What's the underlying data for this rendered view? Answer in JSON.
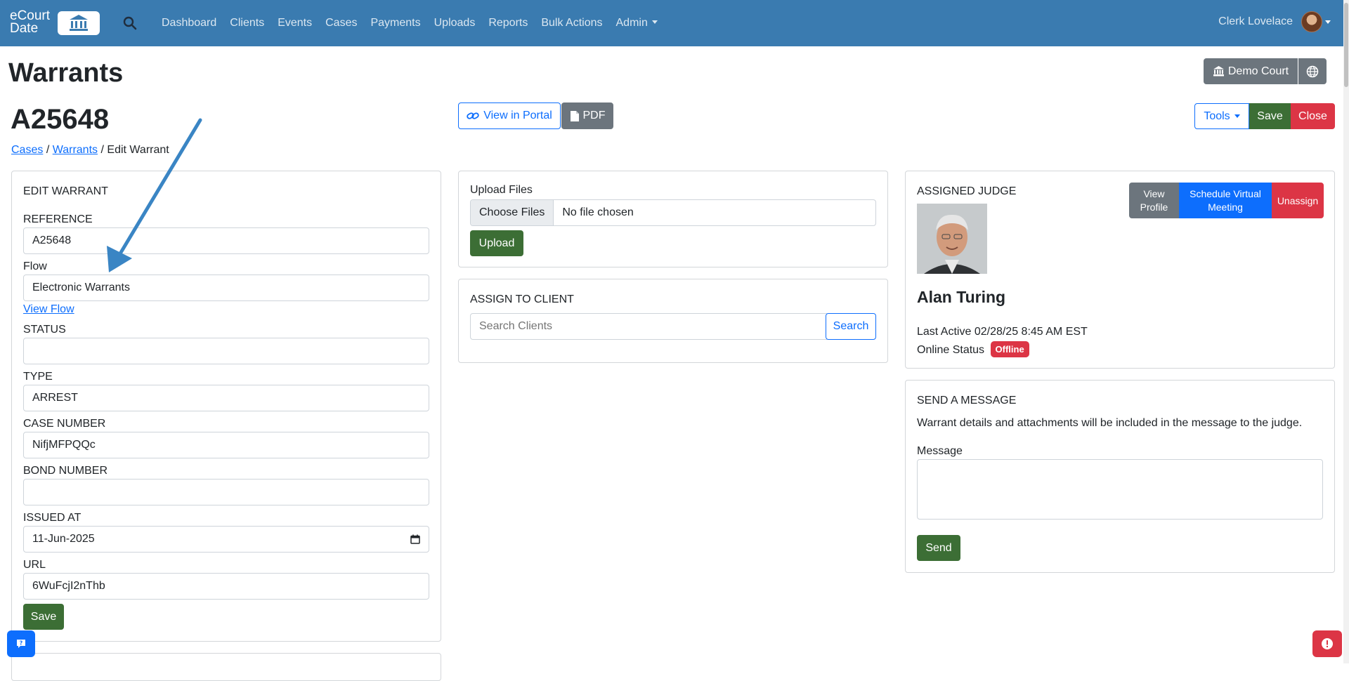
{
  "nav": {
    "brand_line1": "eCourt",
    "brand_line2": "Date",
    "links": [
      "Dashboard",
      "Clients",
      "Events",
      "Cases",
      "Payments",
      "Uploads",
      "Reports",
      "Bulk Actions",
      "Admin"
    ],
    "user_name": "Clerk Lovelace"
  },
  "header": {
    "page_title": "Warrants",
    "record_id": "A25648",
    "breadcrumb": {
      "cases": "Cases",
      "warrants": "Warrants",
      "current": "Edit Warrant",
      "sep": "/"
    },
    "court_button": "Demo Court",
    "view_portal": "View in Portal",
    "pdf": "PDF",
    "tools": "Tools",
    "save": "Save",
    "close": "Close"
  },
  "edit_form": {
    "title": "EDIT WARRANT",
    "reference_label": "REFERENCE",
    "reference_value": "A25648",
    "flow_label": "Flow",
    "flow_value": "Electronic Warrants",
    "view_flow": "View Flow",
    "status_label": "STATUS",
    "status_value": "",
    "type_label": "TYPE",
    "type_value": "ARREST",
    "case_number_label": "CASE NUMBER",
    "case_number_value": "NifjMFPQQc",
    "bond_number_label": "BOND NUMBER",
    "bond_number_value": "",
    "issued_at_label": "ISSUED AT",
    "issued_at_value": "11-Jun-2025",
    "url_label": "URL",
    "url_value": "6WuFcjI2nThb",
    "save": "Save"
  },
  "upload": {
    "label": "Upload Files",
    "choose": "Choose Files",
    "no_file": "No file chosen",
    "upload_button": "Upload"
  },
  "assign_client": {
    "title": "ASSIGN TO CLIENT",
    "placeholder": "Search Clients",
    "search": "Search"
  },
  "judge": {
    "title": "ASSIGNED JUDGE",
    "view_profile": "View Profile",
    "schedule": "Schedule Virtual Meeting",
    "unassign": "Unassign",
    "name": "Alan Turing",
    "last_active": "Last Active 02/28/25 8:45 AM EST",
    "online_label": "Online Status",
    "online_status": "Offline"
  },
  "message": {
    "title": "SEND A MESSAGE",
    "note": "Warrant details and attachments will be included in the message to the judge.",
    "label": "Message",
    "value": "",
    "send": "Send"
  },
  "colors": {
    "navbar": "#3a7bb0",
    "primary": "#0d6efd",
    "success": "#3c6e35",
    "danger": "#dc3545",
    "secondary": "#6c757d",
    "annotation_arrow": "#3a85c4"
  }
}
